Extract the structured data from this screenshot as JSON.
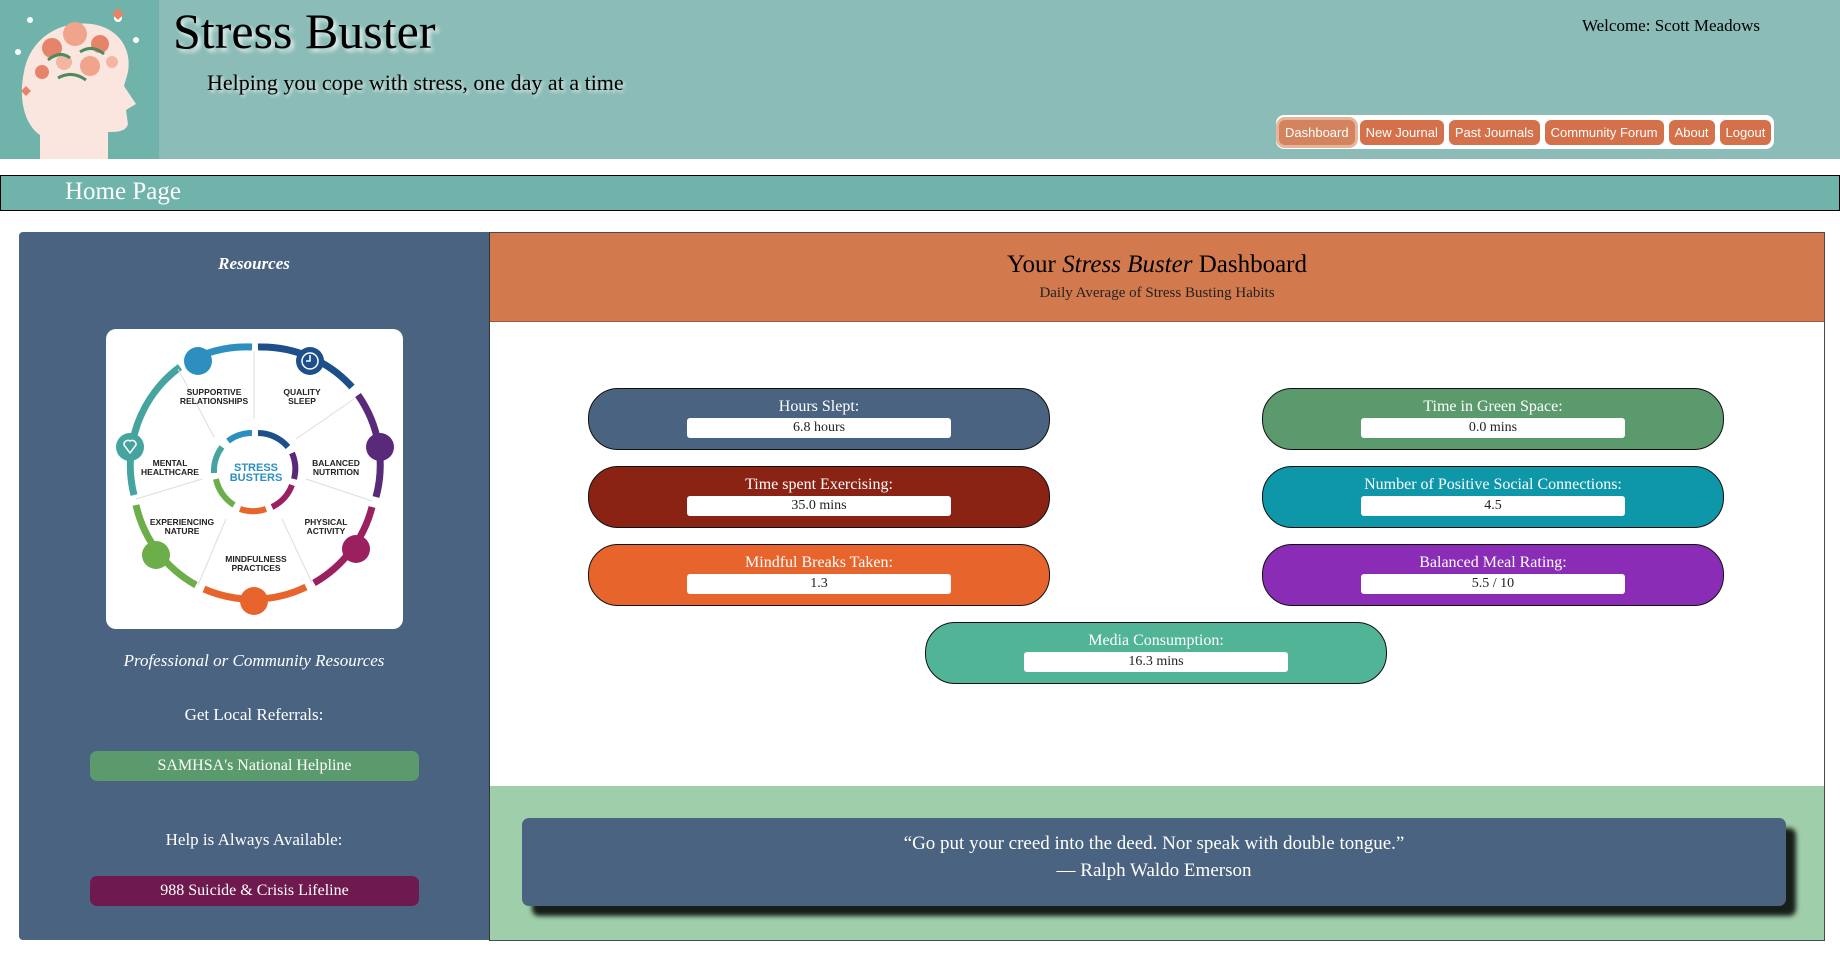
{
  "header": {
    "site_title": "Stress Buster",
    "tagline": "Helping you cope with stress, one day at a time",
    "welcome": "Welcome: Scott Meadows",
    "nav": [
      "Dashboard",
      "New Journal",
      "Past Journals",
      "Community Forum",
      "About",
      "Logout"
    ],
    "active_nav": "Dashboard"
  },
  "page": {
    "title": "Home Page"
  },
  "sidebar": {
    "title": "Resources",
    "wheel": {
      "center": [
        "STRESS",
        "BUSTERS"
      ],
      "segments": [
        [
          "SUPPORTIVE",
          "RELATIONSHIPS"
        ],
        [
          "QUALITY",
          "SLEEP"
        ],
        [
          "BALANCED",
          "NUTRITION"
        ],
        [
          "PHYSICAL",
          "ACTIVITY"
        ],
        [
          "MINDFULNESS",
          "PRACTICES"
        ],
        [
          "EXPERIENCING",
          "NATURE"
        ],
        [
          "MENTAL",
          "HEALTHCARE"
        ]
      ]
    },
    "resources_label": "Professional or Community Resources",
    "referrals_label": "Get Local Referrals:",
    "helpline_button": "SAMHSA's National Helpline",
    "help_label": "Help is Always Available:",
    "crisis_button": "988 Suicide & Crisis Lifeline"
  },
  "dashboard": {
    "title_prefix": "Your",
    "title_italic": "Stress Buster",
    "title_suffix": "Dashboard",
    "subtitle": "Daily Average of Stress Busting Habits",
    "stats": [
      {
        "label": "Hours Slept:",
        "value": "6.8 hours",
        "color": "#4a6380"
      },
      {
        "label": "Time in Green Space:",
        "value": "0.0 mins",
        "color": "#5a9a6d"
      },
      {
        "label": "Time spent Exercising:",
        "value": "35.0 mins",
        "color": "#8a2314"
      },
      {
        "label": "Number of Positive Social Connections:",
        "value": "4.5",
        "color": "#0d97a8"
      },
      {
        "label": "Mindful Breaks Taken:",
        "value": "1.3",
        "color": "#e8642d"
      },
      {
        "label": "Balanced Meal Rating:",
        "value": "5.5 / 10",
        "color": "#8a2cb5"
      },
      {
        "label": "Media Consumption:",
        "value": "16.3 mins",
        "color": "#52b496"
      }
    ]
  },
  "quote": {
    "text": "“Go put your creed into the deed. Nor speak with double tongue.”",
    "author": "— Ralph Waldo Emerson"
  },
  "colors": {
    "header_bg": "#8bbcb7",
    "teal": "#6fb3ab",
    "sidebar_bg": "#4a6380",
    "accent_orange": "#d27a4e",
    "helpline_green": "#5a9a6d",
    "crisis_purple": "#6e1a4f",
    "quote_bg": "#9fceaa"
  }
}
